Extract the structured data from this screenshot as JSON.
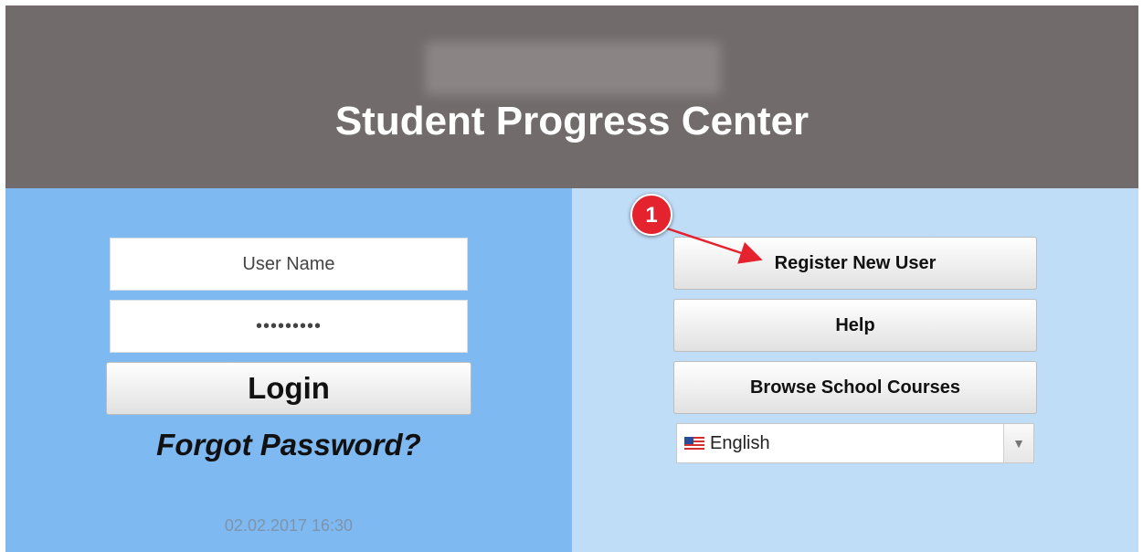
{
  "header": {
    "title": "Student Progress Center"
  },
  "login": {
    "username_placeholder": "User Name",
    "password_value": "•••••••••",
    "login_label": "Login",
    "forgot_label": "Forgot Password?",
    "timestamp": "02.02.2017 16:30"
  },
  "actions": {
    "register_label": "Register New User",
    "help_label": "Help",
    "browse_label": "Browse School Courses"
  },
  "language": {
    "selected": "English",
    "flag_icon": "us-flag-icon",
    "arrow_icon": "chevron-down-icon"
  },
  "annotation": {
    "step_number": "1"
  },
  "colors": {
    "header_bg": "#716c6b",
    "left_panel_bg": "#7fb9f1",
    "right_panel_bg": "#c0ddf8",
    "callout_red": "#e5232f"
  }
}
